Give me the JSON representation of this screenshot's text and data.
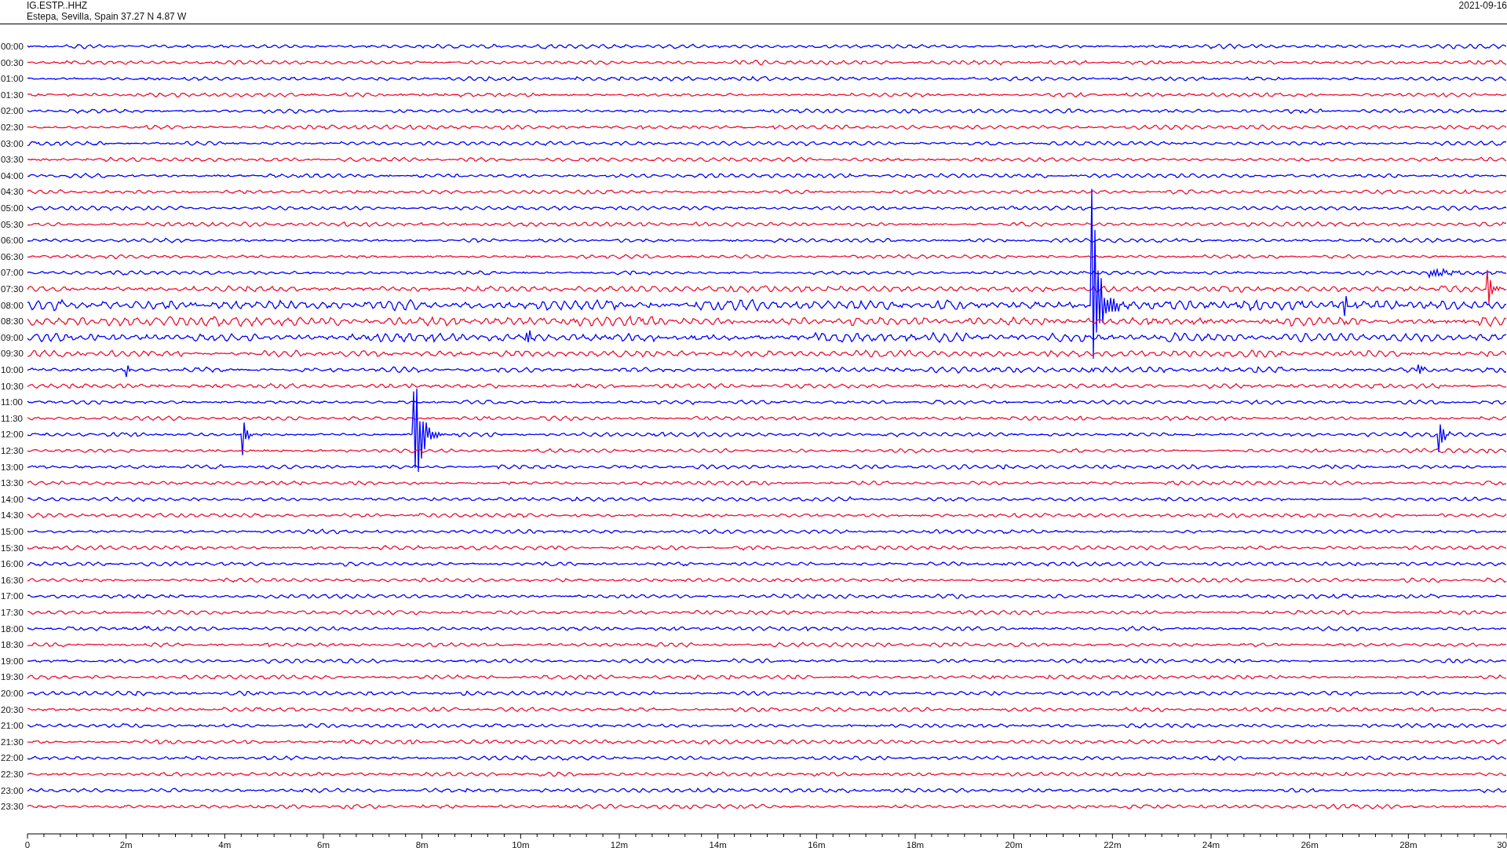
{
  "header": {
    "station": "IG.ESTP..HHZ",
    "location": "Estepa, Sevilla, Spain  37.27 N 4.87 W",
    "date": "2021-09-16"
  },
  "rows": [
    {
      "label": "00:00",
      "color": "#0000ff"
    },
    {
      "label": "00:30",
      "color": "#ee1133"
    },
    {
      "label": "01:00",
      "color": "#0000ff"
    },
    {
      "label": "01:30",
      "color": "#ee1133"
    },
    {
      "label": "02:00",
      "color": "#0000ff"
    },
    {
      "label": "02:30",
      "color": "#ee1133"
    },
    {
      "label": "03:00",
      "color": "#0000ff"
    },
    {
      "label": "03:30",
      "color": "#ee1133"
    },
    {
      "label": "04:00",
      "color": "#0000ff"
    },
    {
      "label": "04:30",
      "color": "#ee1133"
    },
    {
      "label": "05:00",
      "color": "#0000ff"
    },
    {
      "label": "05:30",
      "color": "#ee1133"
    },
    {
      "label": "06:00",
      "color": "#0000ff"
    },
    {
      "label": "06:30",
      "color": "#ee1133"
    },
    {
      "label": "07:00",
      "color": "#0000ff"
    },
    {
      "label": "07:30",
      "color": "#ee1133"
    },
    {
      "label": "08:00",
      "color": "#0000ff"
    },
    {
      "label": "08:30",
      "color": "#ee1133"
    },
    {
      "label": "09:00",
      "color": "#0000ff"
    },
    {
      "label": "09:30",
      "color": "#ee1133"
    },
    {
      "label": "10:00",
      "color": "#0000ff"
    },
    {
      "label": "10:30",
      "color": "#ee1133"
    },
    {
      "label": "11:00",
      "color": "#0000ff"
    },
    {
      "label": "11:30",
      "color": "#ee1133"
    },
    {
      "label": "12:00",
      "color": "#0000ff"
    },
    {
      "label": "12:30",
      "color": "#ee1133"
    },
    {
      "label": "13:00",
      "color": "#0000ff"
    },
    {
      "label": "13:30",
      "color": "#ee1133"
    },
    {
      "label": "14:00",
      "color": "#0000ff"
    },
    {
      "label": "14:30",
      "color": "#ee1133"
    },
    {
      "label": "15:00",
      "color": "#0000ff"
    },
    {
      "label": "15:30",
      "color": "#ee1133"
    },
    {
      "label": "16:00",
      "color": "#0000ff"
    },
    {
      "label": "16:30",
      "color": "#ee1133"
    },
    {
      "label": "17:00",
      "color": "#0000ff"
    },
    {
      "label": "17:30",
      "color": "#ee1133"
    },
    {
      "label": "18:00",
      "color": "#0000ff"
    },
    {
      "label": "18:30",
      "color": "#ee1133"
    },
    {
      "label": "19:00",
      "color": "#0000ff"
    },
    {
      "label": "19:30",
      "color": "#ee1133"
    },
    {
      "label": "20:00",
      "color": "#0000ff"
    },
    {
      "label": "20:30",
      "color": "#ee1133"
    },
    {
      "label": "21:00",
      "color": "#0000ff"
    },
    {
      "label": "21:30",
      "color": "#ee1133"
    },
    {
      "label": "22:00",
      "color": "#0000ff"
    },
    {
      "label": "22:30",
      "color": "#ee1133"
    },
    {
      "label": "23:00",
      "color": "#0000ff"
    },
    {
      "label": "23:30",
      "color": "#ee1133"
    }
  ],
  "axis_labels": [
    "0",
    "2m",
    "4m",
    "6m",
    "8m",
    "10m",
    "12m",
    "14m",
    "16m",
    "18m",
    "20m",
    "22m",
    "24m",
    "26m",
    "28m",
    "30"
  ]
}
